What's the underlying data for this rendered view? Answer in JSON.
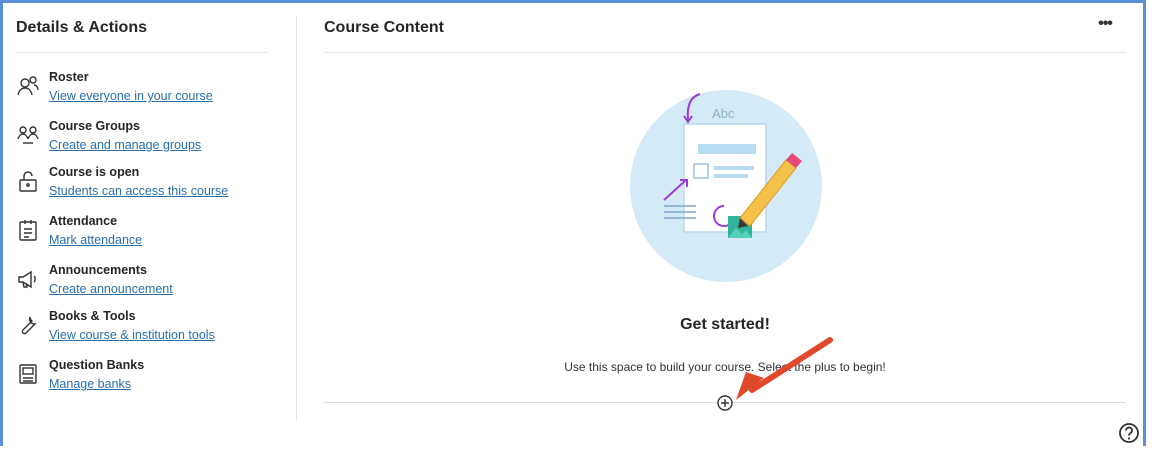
{
  "sidebar": {
    "title": "Details & Actions",
    "items": [
      {
        "title": "Roster",
        "link": "View everyone in your course",
        "icon": "roster-icon"
      },
      {
        "title": "Course Groups",
        "link": "Create and manage groups",
        "icon": "groups-icon"
      },
      {
        "title": "Course is open",
        "link": "Students can access this course",
        "icon": "unlock-icon"
      },
      {
        "title": "Attendance",
        "link": "Mark attendance",
        "icon": "attendance-icon"
      },
      {
        "title": "Announcements",
        "link": "Create announcement",
        "icon": "megaphone-icon"
      },
      {
        "title": "Books & Tools",
        "link": "View course & institution tools",
        "icon": "wrench-icon"
      },
      {
        "title": "Question Banks",
        "link": "Manage banks",
        "icon": "question-bank-icon"
      }
    ]
  },
  "main": {
    "title": "Course Content",
    "more_label": "•••",
    "illustration_text": "Abc",
    "heading": "Get started!",
    "hint": "Use this space to build your course. Select the plus to begin!"
  },
  "colors": {
    "frame": "#5a8fd6",
    "link": "#2b6ea8",
    "illustration_circle": "#d4eaf7",
    "arrow": "#e0492b"
  }
}
